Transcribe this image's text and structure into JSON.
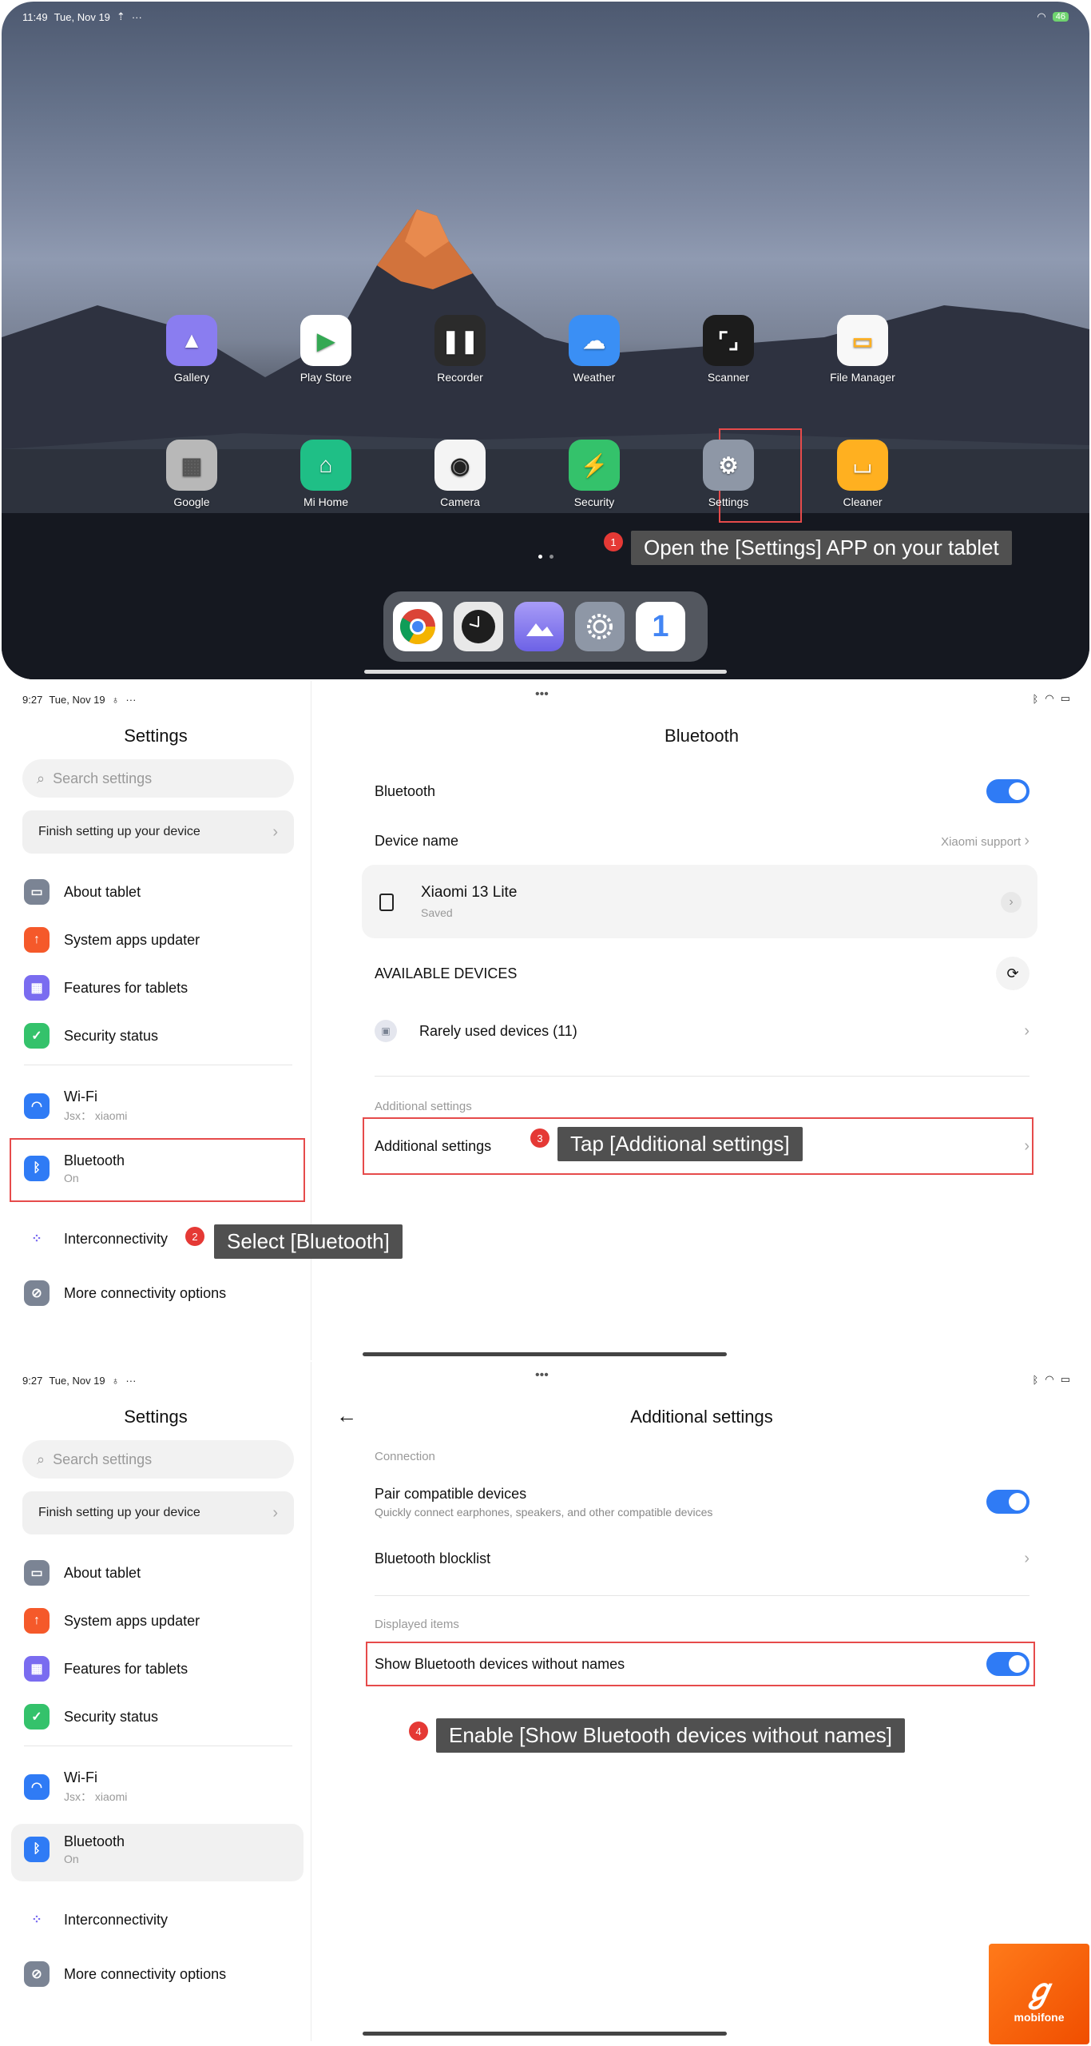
{
  "home": {
    "status_time": "11:49",
    "status_date": "Tue, Nov 19",
    "status_battery": "46",
    "apps_row1": [
      {
        "label": "Gallery",
        "icon": "gallery-icon",
        "color": "#8a7df0"
      },
      {
        "label": "Play Store",
        "icon": "play-store-icon",
        "color": "#ffffff"
      },
      {
        "label": "Recorder",
        "icon": "recorder-icon",
        "color": "#2b2b2b"
      },
      {
        "label": "Weather",
        "icon": "weather-icon",
        "color": "#3a8ff5"
      },
      {
        "label": "Scanner",
        "icon": "scanner-icon",
        "color": "#1c1c1c"
      },
      {
        "label": "File Manager",
        "icon": "file-manager-icon",
        "color": "#f8f8f8"
      }
    ],
    "apps_row2": [
      {
        "label": "Google",
        "icon": "google-folder-icon",
        "color": "#b8b8b8"
      },
      {
        "label": "Mi Home",
        "icon": "mi-home-icon",
        "color": "#1fbf86"
      },
      {
        "label": "Camera",
        "icon": "camera-icon",
        "color": "#f4f4f4"
      },
      {
        "label": "Security",
        "icon": "security-icon",
        "color": "#34c26b"
      },
      {
        "label": "Settings",
        "icon": "settings-gear-icon",
        "color": "#8e97a6"
      },
      {
        "label": "Cleaner",
        "icon": "cleaner-icon",
        "color": "#ffb020"
      }
    ],
    "dock": [
      {
        "icon": "chrome-icon"
      },
      {
        "icon": "clock-icon"
      },
      {
        "icon": "gallery-icon"
      },
      {
        "icon": "settings-gear-icon"
      },
      {
        "icon": "google-one-icon"
      }
    ],
    "step_number": "1",
    "step_text": "Open the [Settings] APP on your tablet"
  },
  "settings_left": {
    "status_time": "9:27",
    "status_date": "Tue, Nov 19",
    "title": "Settings",
    "search_placeholder": "Search settings",
    "finish_label": "Finish setting up your device",
    "items": [
      {
        "label": "About tablet",
        "sub": "",
        "icon": "tablet-icon",
        "color": "#7b8494"
      },
      {
        "label": "System apps updater",
        "sub": "",
        "icon": "update-arrow-icon",
        "color": "#f5592a"
      },
      {
        "label": "Features for tablets",
        "sub": "",
        "icon": "features-grid-icon",
        "color": "#7a6cf0"
      },
      {
        "label": "Security status",
        "sub": "",
        "icon": "security-shield-icon",
        "color": "#34c26b"
      },
      {
        "label": "Wi-Fi",
        "sub": "Jsx： xiaomi",
        "icon": "wifi-icon",
        "color": "#2f7bf5"
      },
      {
        "label": "Bluetooth",
        "sub": "On",
        "icon": "bluetooth-icon",
        "color": "#2f7bf5"
      },
      {
        "label": "Interconnectivity",
        "sub": "",
        "icon": "interconnectivity-icon",
        "color": "#ffffff"
      },
      {
        "label": "More connectivity options",
        "sub": "",
        "icon": "connectivity-icon",
        "color": "#7b8494"
      }
    ]
  },
  "bluetooth_page": {
    "title": "Bluetooth",
    "bluetooth_label": "Bluetooth",
    "device_name_label": "Device name",
    "device_name_value": "Xiaomi support",
    "saved_device_name": "Xiaomi 13 Lite",
    "saved_device_status": "Saved",
    "available_header": "AVAILABLE DEVICES",
    "rarely_used": "Rarely used devices (11)",
    "additional_caption": "Additional settings",
    "additional_label": "Additional settings",
    "step2_number": "2",
    "step2_text": "Select [Bluetooth]",
    "step3_number": "3",
    "step3_text": "Tap [Additional settings]"
  },
  "additional_page": {
    "title": "Additional settings",
    "connection_caption": "Connection",
    "pair_label": "Pair compatible devices",
    "pair_sub": "Quickly connect earphones, speakers, and other compatible devices",
    "blocklist_label": "Bluetooth blocklist",
    "displayed_caption": "Displayed items",
    "show_label": "Show Bluetooth devices without names",
    "step4_number": "4",
    "step4_text": "Enable [Show Bluetooth devices without names]"
  },
  "watermark": {
    "text": "mobifone"
  }
}
